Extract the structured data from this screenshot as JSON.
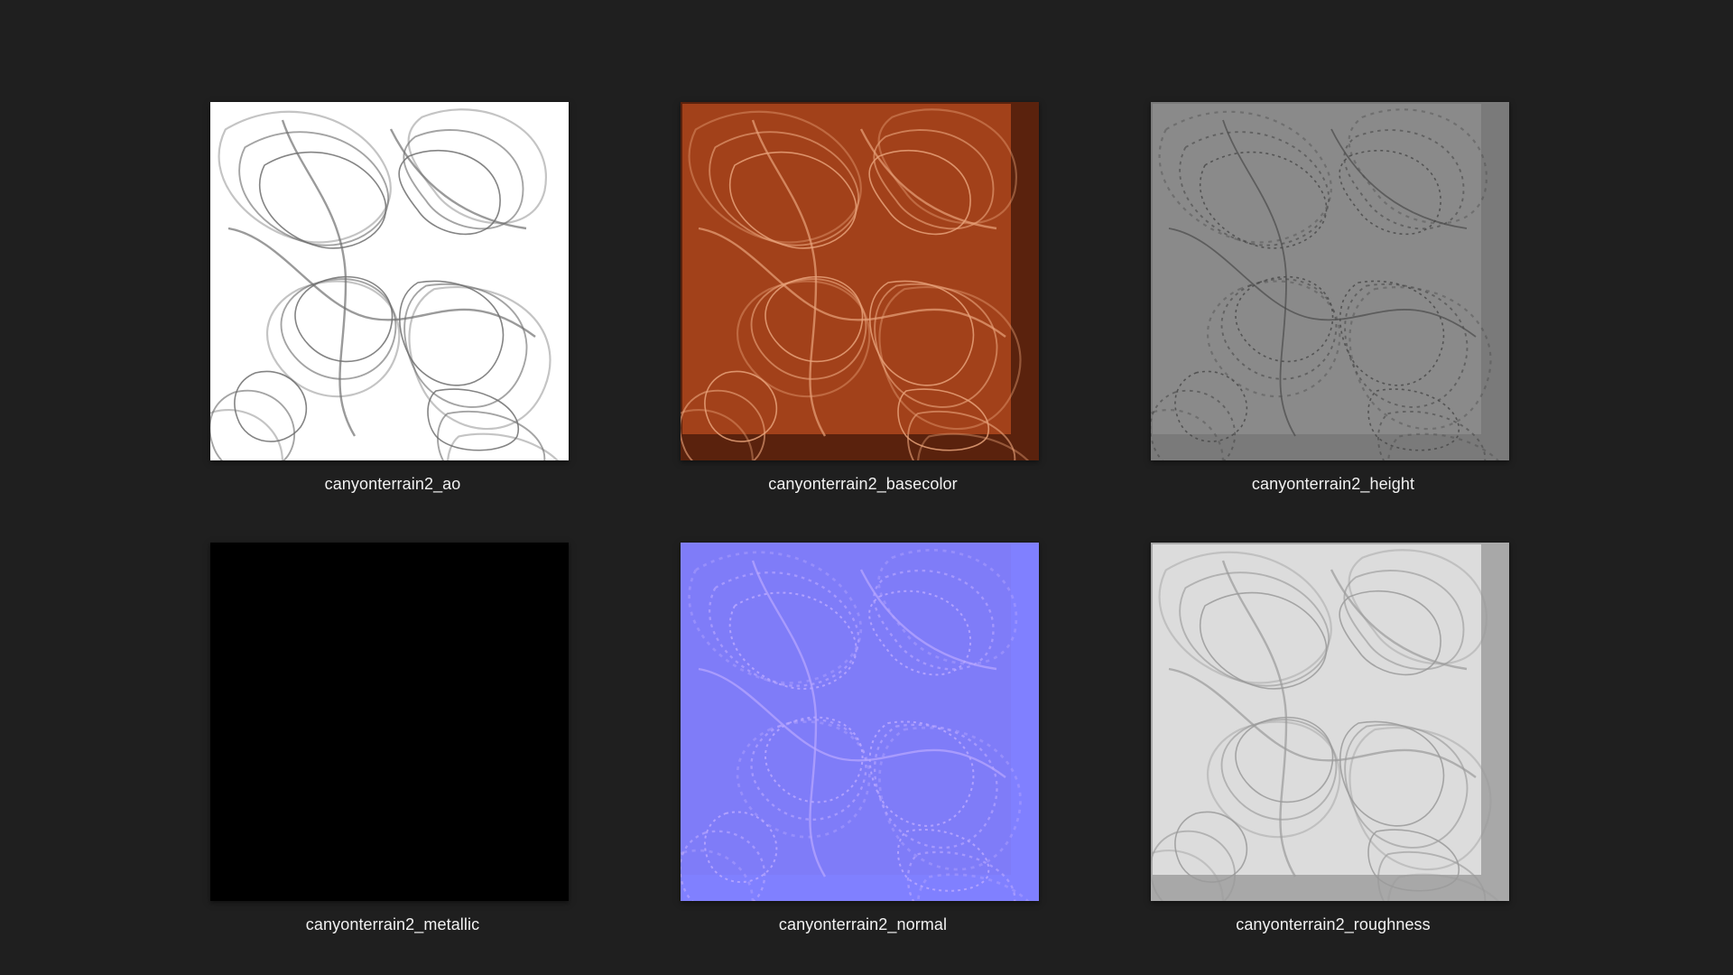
{
  "files": [
    {
      "name": "canyonterrain2_ao",
      "kind": "ao",
      "base_color": "#ffffff",
      "line_color": "#6f6f6f",
      "border_color": "#ffffff"
    },
    {
      "name": "canyonterrain2_basecolor",
      "kind": "basecolor",
      "base_color": "#a2411a",
      "line_color": "#e8a27a",
      "border_color": "#5a220d"
    },
    {
      "name": "canyonterrain2_height",
      "kind": "height",
      "base_color": "#8a8a8a",
      "line_color": "#4a4a4a",
      "border_color": "#7a7a7a"
    },
    {
      "name": "canyonterrain2_metallic",
      "kind": "metallic",
      "base_color": "#000000",
      "line_color": "#000000",
      "border_color": "#000000"
    },
    {
      "name": "canyonterrain2_normal",
      "kind": "normal",
      "base_color": "#7f7cf8",
      "line_color": "#b9a8ff",
      "border_color": "#8080ff"
    },
    {
      "name": "canyonterrain2_roughness",
      "kind": "roughness",
      "base_color": "#dcdcdc",
      "line_color": "#9a9a9a",
      "border_color": "#a8a8a8"
    }
  ]
}
